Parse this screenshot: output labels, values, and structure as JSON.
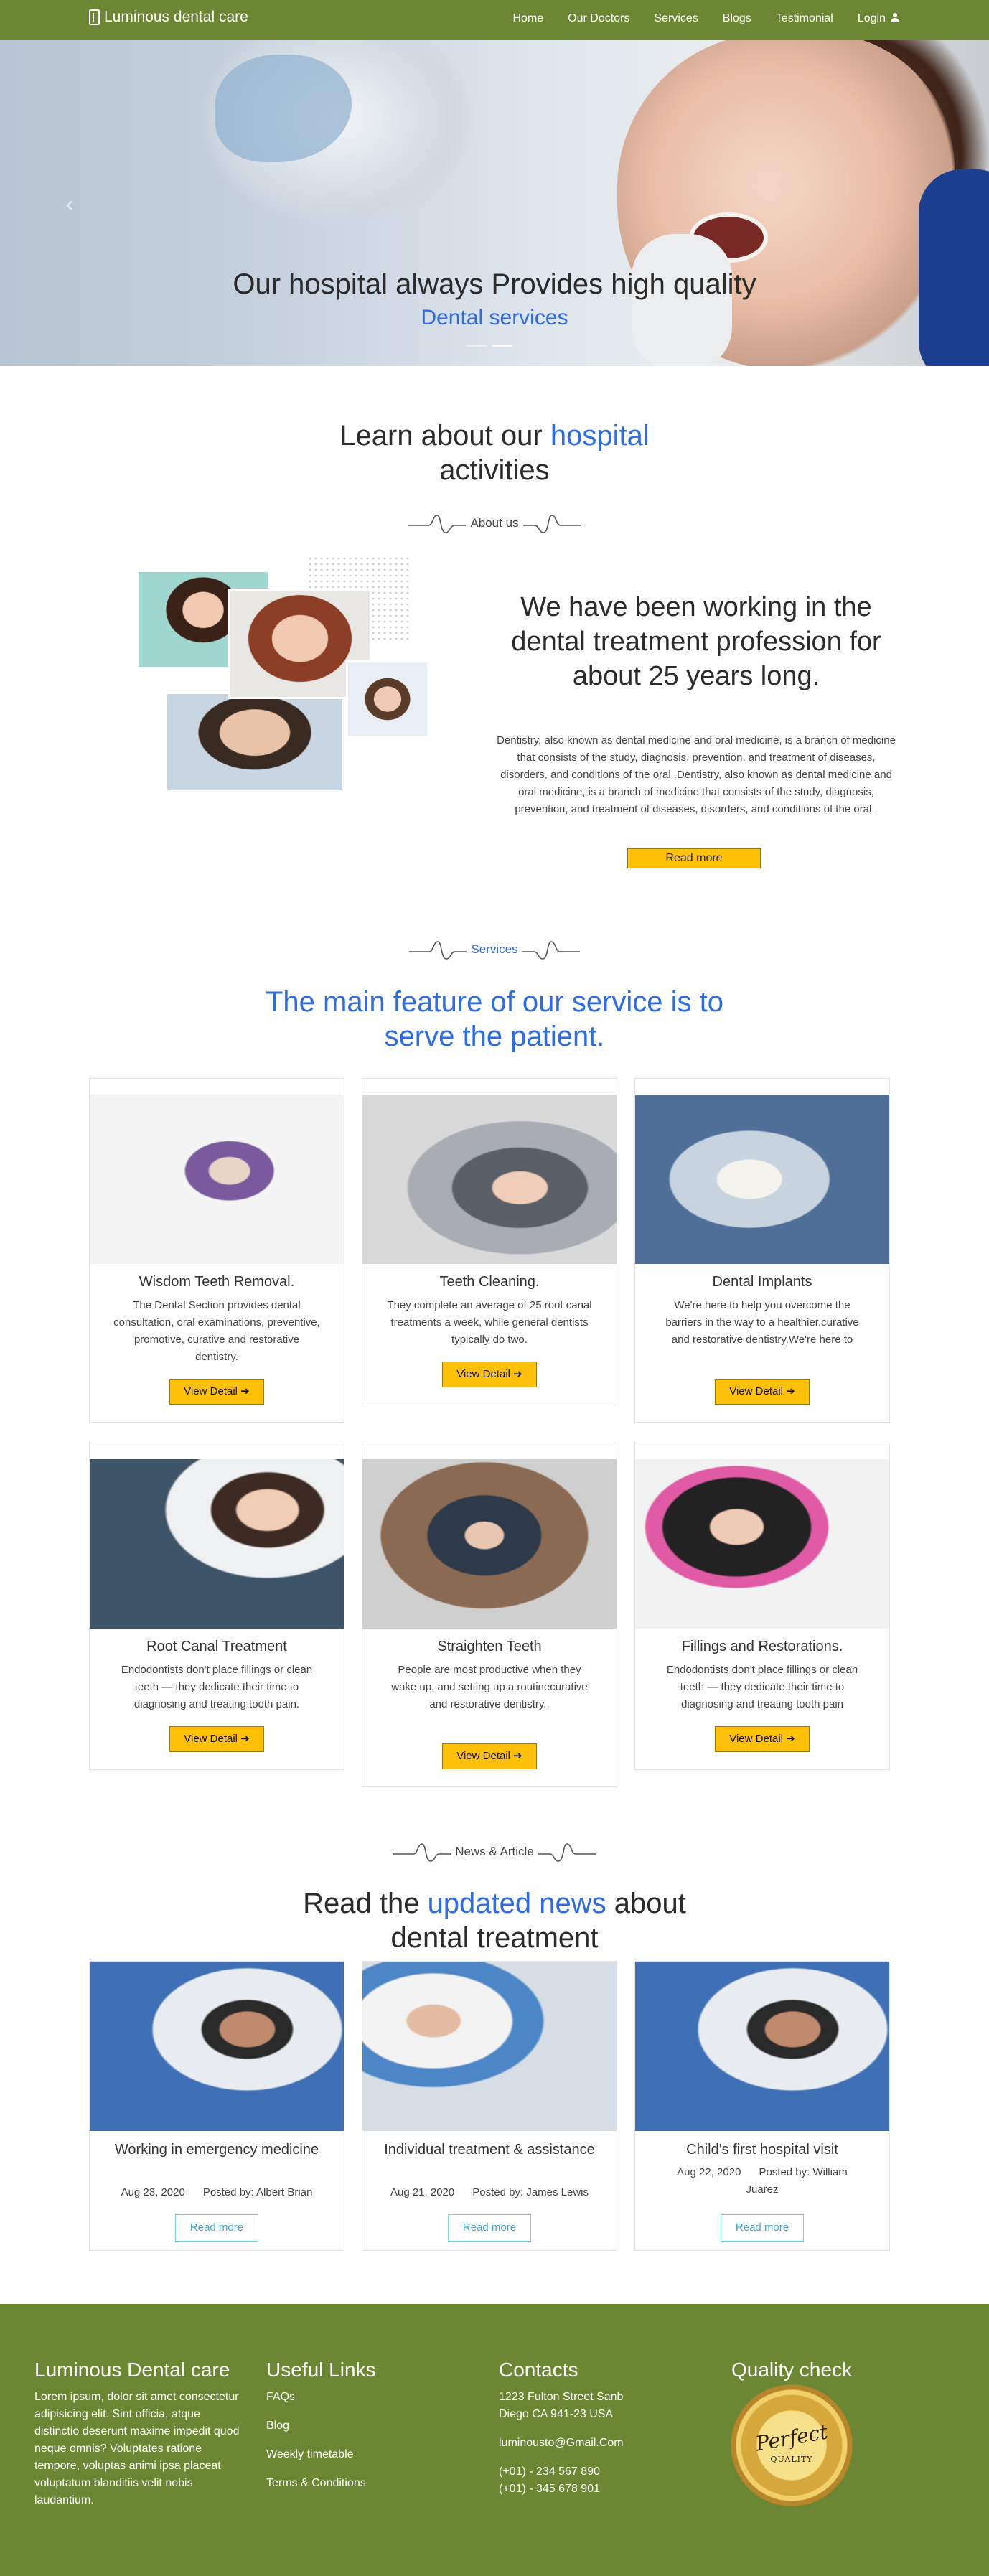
{
  "nav": {
    "brand": "Luminous dental care",
    "items": [
      "Home",
      "Our Doctors",
      "Services",
      "Blogs",
      "Testimonial",
      "Login"
    ]
  },
  "hero": {
    "title": "Our hospital always Provides high quality",
    "subtitle": "Dental services",
    "prev_icon": "‹"
  },
  "about": {
    "heading_pre": "Learn about our",
    "heading_blue": "hospital",
    "heading_post": "activities",
    "tag": "About us",
    "title": "We have been working in the dental treatment profession for about 25 years long.",
    "text": "Dentistry, also known as dental medicine and oral medicine, is a branch of medicine that consists of the study, diagnosis, prevention, and treatment of diseases, disorders, and conditions of the oral .Dentistry, also known as dental medicine and oral medicine, is a branch of medicine that consists of the study, diagnosis, prevention, and treatment of diseases, disorders, and conditions of the oral .",
    "button": "Read more"
  },
  "services": {
    "tag": "Services",
    "heading": "The main feature of our service is to serve the patient.",
    "button_label": "View Detail",
    "button_icon": "➔",
    "cards": [
      {
        "title": "Wisdom Teeth Removal.",
        "text": "The Dental Section provides dental consultation, oral examinations, preventive, promotive, curative and restorative dentistry."
      },
      {
        "title": "Teeth Cleaning.",
        "text": "They complete an average of 25 root canal treatments a week, while general dentists typically do two."
      },
      {
        "title": "Dental Implants",
        "text": "We're here to help you overcome the barriers in the way to a healthier.curative and restorative dentistry.We're here to"
      },
      {
        "title": "Root Canal Treatment",
        "text": "Endodontists don't place fillings or clean teeth — they dedicate their time to diagnosing and treating tooth pain."
      },
      {
        "title": "Straighten Teeth",
        "text": "People are most productive when they wake up, and setting up a routinecurative and restorative dentistry.."
      },
      {
        "title": "Fillings and Restorations.",
        "text": "Endodontists don't place fillings or clean teeth — they dedicate their time to diagnosing and treating tooth pain"
      }
    ]
  },
  "news": {
    "tag": "News & Article",
    "heading_pre": "Read the",
    "heading_blue": "updated news",
    "heading_post": "about dental treatment",
    "button": "Read more",
    "items": [
      {
        "title": "Working in emergency medicine",
        "date": "Aug 23, 2020",
        "author": "Posted by: Albert Brian"
      },
      {
        "title": "Individual treatment & assistance",
        "date": "Aug 21, 2020",
        "author": "Posted by: James Lewis"
      },
      {
        "title": "Child's first hospital visit",
        "date": "Aug 22, 2020",
        "author": "Posted by: William Juarez"
      }
    ]
  },
  "footer": {
    "about_title": "Luminous Dental care",
    "about_text": "Lorem ipsum, dolor sit amet consectetur adipisicing elit. Sint officia, atque distinctio deserunt maxime impedit quod neque omnis? Voluptates ratione tempore, voluptas animi ipsa placeat voluptatum blanditiis velit nobis laudantium.",
    "links_title": "Useful Links",
    "links": [
      "FAQs",
      "Blog",
      "Weekly timetable",
      "Terms & Conditions"
    ],
    "contacts_title": "Contacts",
    "address1": "1223 Fulton Street Sanb",
    "address2": "Diego CA 941-23 USA",
    "email": "luminousto@Gmail.Com",
    "phone1": "(+01) - 234 567 890",
    "phone2": "(+01) - 345 678 901",
    "quality_title": "Quality check",
    "seal_line1": "Perfect",
    "seal_line2": "QUALITY"
  },
  "colors": {
    "brand_green": "#6b8733",
    "accent_blue": "#2e6be6",
    "button_yellow": "#ffc107"
  }
}
